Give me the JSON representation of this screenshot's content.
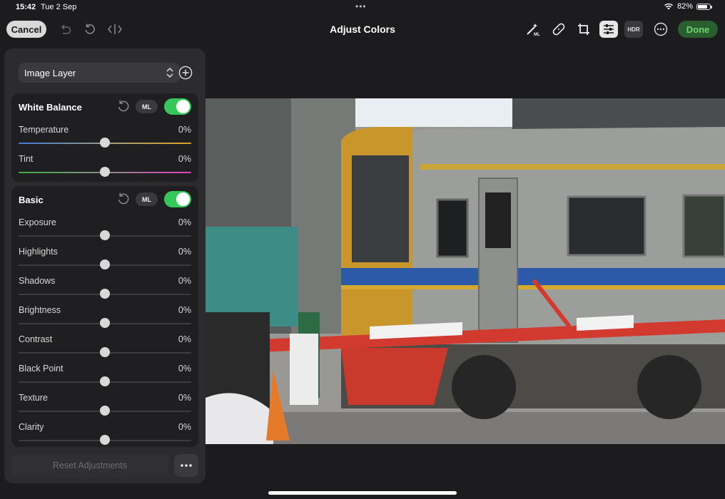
{
  "status_bar": {
    "time": "15:42",
    "date": "Tue 2 Sep",
    "battery": "82%",
    "battery_level": 0.82
  },
  "toolbar": {
    "cancel_label": "Cancel",
    "title": "Adjust Colors",
    "done_label": "Done",
    "hdr_label": "HDR",
    "ml_label": "ML"
  },
  "panel": {
    "layer_selector": "Image Layer",
    "sections": [
      {
        "title": "White Balance",
        "ml_label": "ML",
        "enabled": true,
        "sliders": [
          {
            "label": "Temperature",
            "value": "0%",
            "level": 0.5
          },
          {
            "label": "Tint",
            "value": "0%",
            "level": 0.5
          }
        ]
      },
      {
        "title": "Basic",
        "ml_label": "ML",
        "enabled": true,
        "sliders": [
          {
            "label": "Exposure",
            "value": "0%",
            "level": 0.5
          },
          {
            "label": "Highlights",
            "value": "0%",
            "level": 0.5
          },
          {
            "label": "Shadows",
            "value": "0%",
            "level": 0.5
          },
          {
            "label": "Brightness",
            "value": "0%",
            "level": 0.5
          },
          {
            "label": "Contrast",
            "value": "0%",
            "level": 0.5
          },
          {
            "label": "Black Point",
            "value": "0%",
            "level": 0.5
          },
          {
            "label": "Texture",
            "value": "0%",
            "level": 0.5
          },
          {
            "label": "Clarity",
            "value": "0%",
            "level": 0.5
          }
        ]
      }
    ],
    "reset_label": "Reset Adjustments"
  },
  "colors": {
    "accent_green": "#35c759",
    "done_bg": "#2a5e2e",
    "done_text": "#6fd46f",
    "panel_bg": "#2c2c2e"
  }
}
